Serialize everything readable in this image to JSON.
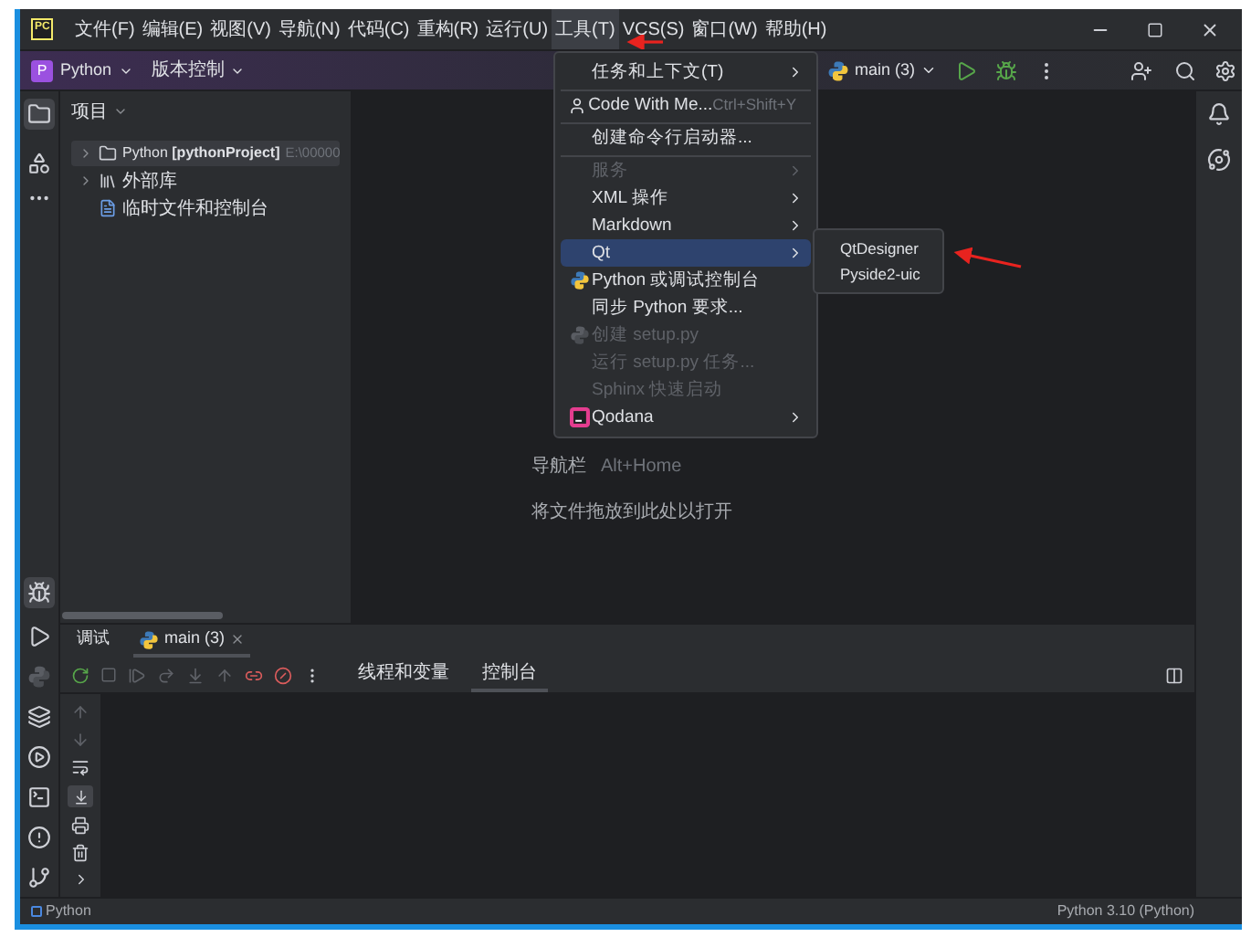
{
  "window": {
    "logo_text": "PC",
    "menu": [
      {
        "label": "文件(F)",
        "selected": false
      },
      {
        "label": "编辑(E)",
        "selected": false
      },
      {
        "label": "视图(V)",
        "selected": false
      },
      {
        "label": "导航(N)",
        "selected": false
      },
      {
        "label": "代码(C)",
        "selected": false
      },
      {
        "label": "重构(R)",
        "selected": false
      },
      {
        "label": "运行(U)",
        "selected": false
      },
      {
        "label": "工具(T)",
        "selected": true
      },
      {
        "label": "VCS(S)",
        "selected": false
      },
      {
        "label": "窗口(W)",
        "selected": false
      },
      {
        "label": "帮助(H)",
        "selected": false
      }
    ]
  },
  "toolbar": {
    "project_badge": "P",
    "project": "Python",
    "vcs": "版本控制",
    "run_config": "main (3)"
  },
  "tools_menu": [
    {
      "label": "任务和上下文(T)",
      "submenu": true,
      "disabled": false,
      "selected": false,
      "separator_before": false
    },
    {
      "label": "Code With Me...",
      "shortcut": "Ctrl+Shift+Y",
      "kind": "user",
      "submenu": false,
      "disabled": false,
      "selected": false,
      "separator_before": true
    },
    {
      "label": "创建命令行启动器...",
      "submenu": false,
      "disabled": false,
      "selected": false,
      "separator_before": true
    },
    {
      "label": "服务",
      "submenu": true,
      "disabled": true,
      "selected": false,
      "separator_before": true
    },
    {
      "label": "XML 操作",
      "submenu": true,
      "disabled": false,
      "selected": false,
      "separator_before": false
    },
    {
      "label": "Markdown",
      "submenu": true,
      "disabled": false,
      "selected": false,
      "separator_before": false
    },
    {
      "label": "Qt",
      "submenu": true,
      "disabled": false,
      "selected": true,
      "separator_before": false
    },
    {
      "label": "Python 或调试控制台",
      "kind": "python",
      "submenu": false,
      "disabled": false,
      "selected": false,
      "separator_before": false
    },
    {
      "label": "同步 Python 要求...",
      "submenu": false,
      "disabled": false,
      "selected": false,
      "separator_before": false
    },
    {
      "label": "创建 setup.py",
      "kind": "python",
      "submenu": false,
      "disabled": true,
      "selected": false,
      "separator_before": false
    },
    {
      "label": "运行 setup.py 任务...",
      "submenu": false,
      "disabled": true,
      "selected": false,
      "separator_before": false
    },
    {
      "label": "Sphinx 快速启动",
      "submenu": false,
      "disabled": true,
      "selected": false,
      "separator_before": false
    },
    {
      "label": "Qodana",
      "kind": "qodana",
      "submenu": true,
      "disabled": false,
      "selected": false,
      "separator_before": false
    }
  ],
  "qt_submenu": [
    "QtDesigner",
    "Pyside2-uic"
  ],
  "project_panel": {
    "title": "项目",
    "tree": [
      {
        "kind": "folder",
        "label": "Python **[pythonProject]**",
        "path": "E:\\00000",
        "expanded": false,
        "selected": true
      },
      {
        "kind": "library",
        "label": "外部库",
        "expanded": false,
        "selected": false
      },
      {
        "kind": "scratch",
        "label": "临时文件和控制台",
        "selected": false
      }
    ]
  },
  "editor_hints": [
    {
      "label": "导航栏",
      "shortcut": "Alt+Home"
    },
    {
      "label": "将文件拖放到此处以打开"
    }
  ],
  "debug_panel": {
    "tabs": [
      {
        "label": "调试",
        "selected": false,
        "closable": false
      },
      {
        "label": "main (3)",
        "selected": true,
        "closable": true
      }
    ],
    "subtabs": [
      {
        "label": "线程和变量",
        "selected": false
      },
      {
        "label": "控制台",
        "selected": true
      }
    ]
  },
  "status_bar": {
    "left": "Python",
    "right": "Python 3.10 (Python)"
  }
}
